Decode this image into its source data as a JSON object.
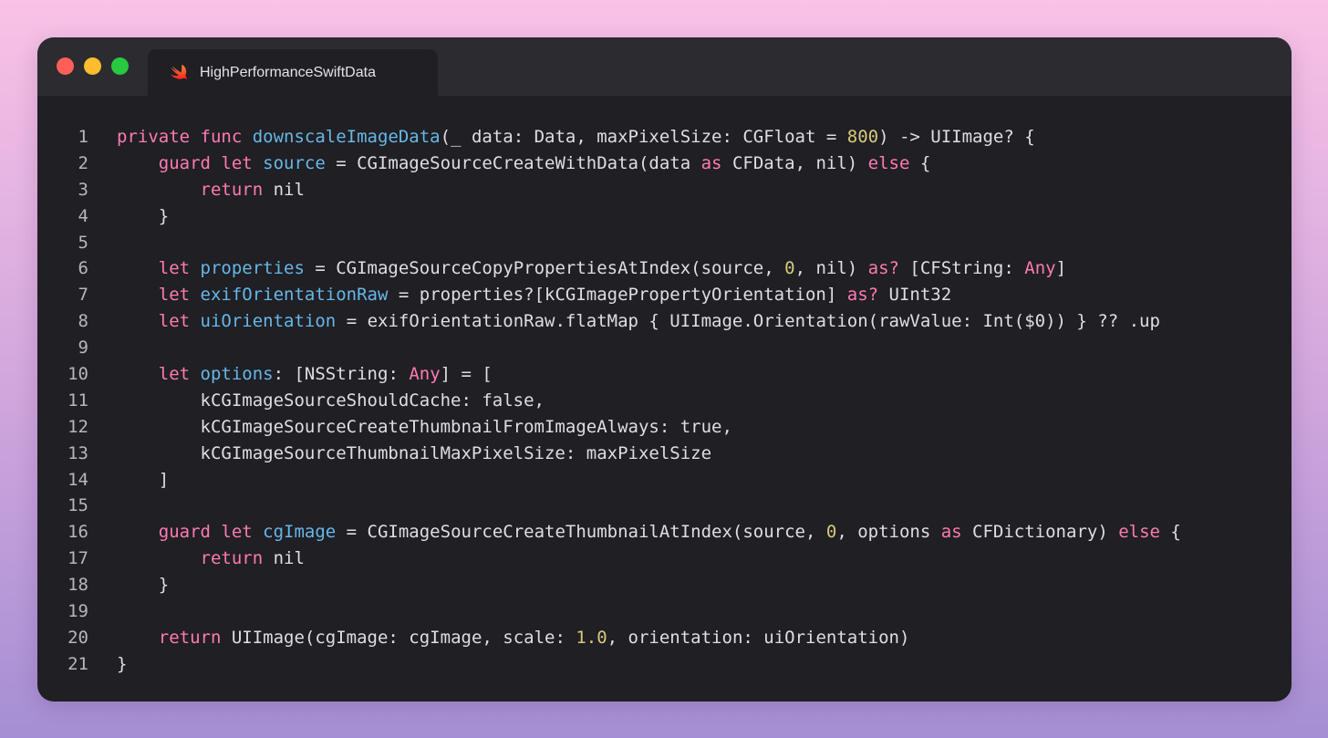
{
  "window": {
    "tab_title": "HighPerformanceSwiftData",
    "tab_icon": "swift-logo-icon"
  },
  "colors": {
    "keyword": "#ff7ab2",
    "declaration": "#67b7e8",
    "number": "#d9c97c",
    "plain": "#dfdfe3",
    "editor_background": "#1f1f24"
  },
  "code": {
    "lines": [
      {
        "n": "1",
        "tokens": [
          {
            "t": "private func ",
            "k": "kw"
          },
          {
            "t": "downscaleImageData",
            "k": "dn"
          },
          {
            "t": "(_ data: Data, maxPixelSize: CGFloat = ",
            "k": "pl"
          },
          {
            "t": "800",
            "k": "num"
          },
          {
            "t": ") -> UIImage? {",
            "k": "pl"
          }
        ]
      },
      {
        "n": "2",
        "tokens": [
          {
            "t": "    ",
            "k": "pl"
          },
          {
            "t": "guard let ",
            "k": "kw"
          },
          {
            "t": "source",
            "k": "dn"
          },
          {
            "t": " = CGImageSourceCreateWithData(data ",
            "k": "pl"
          },
          {
            "t": "as",
            "k": "kw"
          },
          {
            "t": " CFData, nil) ",
            "k": "pl"
          },
          {
            "t": "else",
            "k": "kw"
          },
          {
            "t": " {",
            "k": "pl"
          }
        ]
      },
      {
        "n": "3",
        "tokens": [
          {
            "t": "        ",
            "k": "pl"
          },
          {
            "t": "return",
            "k": "kw"
          },
          {
            "t": " nil",
            "k": "pl"
          }
        ]
      },
      {
        "n": "4",
        "tokens": [
          {
            "t": "    }",
            "k": "pl"
          }
        ]
      },
      {
        "n": "5",
        "tokens": []
      },
      {
        "n": "6",
        "tokens": [
          {
            "t": "    ",
            "k": "pl"
          },
          {
            "t": "let ",
            "k": "kw"
          },
          {
            "t": "properties",
            "k": "dn"
          },
          {
            "t": " = CGImageSourceCopyPropertiesAtIndex(source, ",
            "k": "pl"
          },
          {
            "t": "0",
            "k": "num"
          },
          {
            "t": ", nil) ",
            "k": "pl"
          },
          {
            "t": "as?",
            "k": "kw"
          },
          {
            "t": " [CFString: ",
            "k": "pl"
          },
          {
            "t": "Any",
            "k": "kw"
          },
          {
            "t": "]",
            "k": "pl"
          }
        ]
      },
      {
        "n": "7",
        "tokens": [
          {
            "t": "    ",
            "k": "pl"
          },
          {
            "t": "let ",
            "k": "kw"
          },
          {
            "t": "exifOrientationRaw",
            "k": "dn"
          },
          {
            "t": " = properties?[kCGImagePropertyOrientation] ",
            "k": "pl"
          },
          {
            "t": "as?",
            "k": "kw"
          },
          {
            "t": " UInt32",
            "k": "pl"
          }
        ]
      },
      {
        "n": "8",
        "tokens": [
          {
            "t": "    ",
            "k": "pl"
          },
          {
            "t": "let ",
            "k": "kw"
          },
          {
            "t": "uiOrientation",
            "k": "dn"
          },
          {
            "t": " = exifOrientationRaw.flatMap { UIImage.Orientation(rawValue: Int($0)) } ?? .up",
            "k": "pl"
          }
        ]
      },
      {
        "n": "9",
        "tokens": []
      },
      {
        "n": "10",
        "tokens": [
          {
            "t": "    ",
            "k": "pl"
          },
          {
            "t": "let ",
            "k": "kw"
          },
          {
            "t": "options",
            "k": "dn"
          },
          {
            "t": ": [NSString: ",
            "k": "pl"
          },
          {
            "t": "Any",
            "k": "kw"
          },
          {
            "t": "] = [",
            "k": "pl"
          }
        ]
      },
      {
        "n": "11",
        "tokens": [
          {
            "t": "        kCGImageSourceShouldCache: false,",
            "k": "pl"
          }
        ]
      },
      {
        "n": "12",
        "tokens": [
          {
            "t": "        kCGImageSourceCreateThumbnailFromImageAlways: true,",
            "k": "pl"
          }
        ]
      },
      {
        "n": "13",
        "tokens": [
          {
            "t": "        kCGImageSourceThumbnailMaxPixelSize: maxPixelSize",
            "k": "pl"
          }
        ]
      },
      {
        "n": "14",
        "tokens": [
          {
            "t": "    ]",
            "k": "pl"
          }
        ]
      },
      {
        "n": "15",
        "tokens": []
      },
      {
        "n": "16",
        "tokens": [
          {
            "t": "    ",
            "k": "pl"
          },
          {
            "t": "guard let ",
            "k": "kw"
          },
          {
            "t": "cgImage",
            "k": "dn"
          },
          {
            "t": " = CGImageSourceCreateThumbnailAtIndex(source, ",
            "k": "pl"
          },
          {
            "t": "0",
            "k": "num"
          },
          {
            "t": ", options ",
            "k": "pl"
          },
          {
            "t": "as",
            "k": "kw"
          },
          {
            "t": " CFDictionary) ",
            "k": "pl"
          },
          {
            "t": "else",
            "k": "kw"
          },
          {
            "t": " {",
            "k": "pl"
          }
        ]
      },
      {
        "n": "17",
        "tokens": [
          {
            "t": "        ",
            "k": "pl"
          },
          {
            "t": "return",
            "k": "kw"
          },
          {
            "t": " nil",
            "k": "pl"
          }
        ]
      },
      {
        "n": "18",
        "tokens": [
          {
            "t": "    }",
            "k": "pl"
          }
        ]
      },
      {
        "n": "19",
        "tokens": []
      },
      {
        "n": "20",
        "tokens": [
          {
            "t": "    ",
            "k": "pl"
          },
          {
            "t": "return",
            "k": "kw"
          },
          {
            "t": " UIImage(cgImage: cgImage, scale: ",
            "k": "pl"
          },
          {
            "t": "1.0",
            "k": "num"
          },
          {
            "t": ", orientation: uiOrientation)",
            "k": "pl"
          }
        ]
      },
      {
        "n": "21",
        "tokens": [
          {
            "t": "}",
            "k": "pl"
          }
        ]
      }
    ]
  }
}
